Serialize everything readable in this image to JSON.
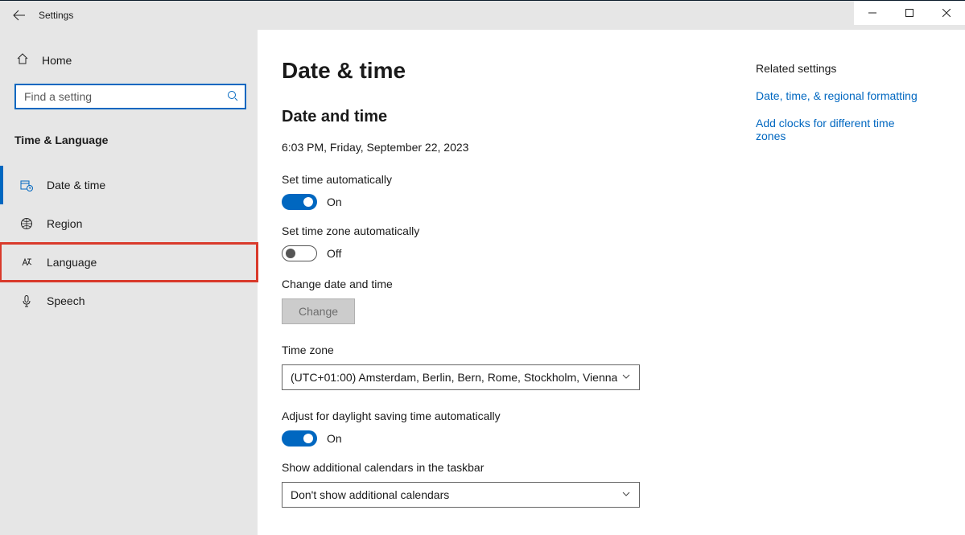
{
  "titlebar": {
    "title": "Settings"
  },
  "sidebar": {
    "home": "Home",
    "search_placeholder": "Find a setting",
    "section": "Time & Language",
    "items": [
      {
        "label": "Date & time"
      },
      {
        "label": "Region"
      },
      {
        "label": "Language"
      },
      {
        "label": "Speech"
      }
    ]
  },
  "page": {
    "title": "Date & time",
    "section": "Date and time",
    "current_datetime": "6:03 PM, Friday, September 22, 2023",
    "set_time_auto": {
      "label": "Set time automatically",
      "state": "On"
    },
    "set_tz_auto": {
      "label": "Set time zone automatically",
      "state": "Off"
    },
    "change_date": {
      "label": "Change date and time",
      "button": "Change"
    },
    "timezone": {
      "label": "Time zone",
      "value": "(UTC+01:00) Amsterdam, Berlin, Bern, Rome, Stockholm, Vienna"
    },
    "dst": {
      "label": "Adjust for daylight saving time automatically",
      "state": "On"
    },
    "additional_calendars": {
      "label": "Show additional calendars in the taskbar",
      "value": "Don't show additional calendars"
    }
  },
  "related": {
    "heading": "Related settings",
    "links": [
      "Date, time, & regional formatting",
      "Add clocks for different time zones"
    ]
  }
}
